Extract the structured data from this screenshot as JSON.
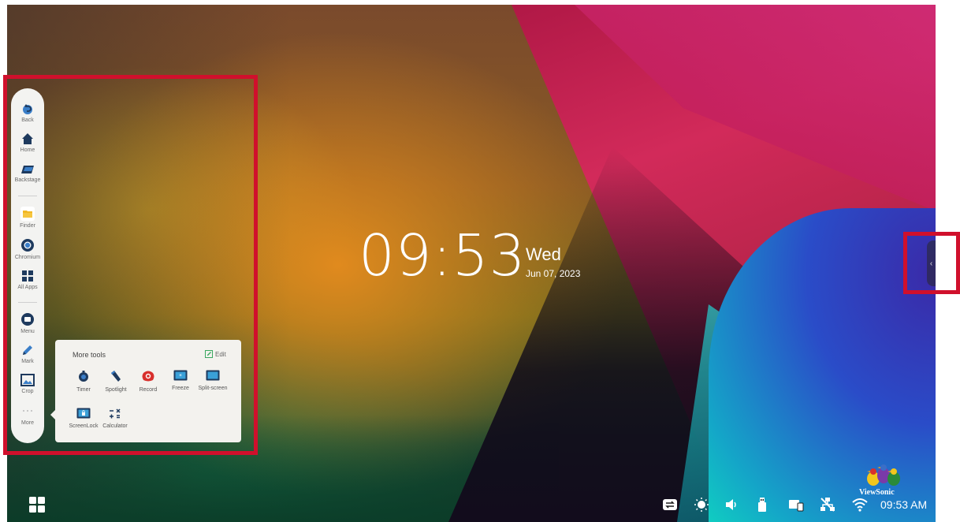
{
  "clock": {
    "time": "09:53",
    "day": "Wed",
    "date": "Jun 07, 2023"
  },
  "sidebar": {
    "items": [
      {
        "label": "Back",
        "icon": "back-icon"
      },
      {
        "label": "Home",
        "icon": "home-icon"
      },
      {
        "label": "Backstage",
        "icon": "backstage-icon"
      },
      {
        "label": "Finder",
        "icon": "folder-icon"
      },
      {
        "label": "Chromium",
        "icon": "chromium-icon"
      },
      {
        "label": "All Apps",
        "icon": "grid-icon"
      },
      {
        "label": "Menu",
        "icon": "menu-icon"
      },
      {
        "label": "Mark",
        "icon": "pen-icon"
      },
      {
        "label": "Crop",
        "icon": "crop-icon"
      },
      {
        "label": "More",
        "icon": "more-dots-icon"
      }
    ]
  },
  "tools_panel": {
    "title": "More tools",
    "edit_label": "Edit",
    "tools": [
      {
        "label": "Timer",
        "icon": "timer-icon"
      },
      {
        "label": "Spotlight",
        "icon": "spotlight-icon"
      },
      {
        "label": "Record",
        "icon": "record-icon"
      },
      {
        "label": "Freeze",
        "icon": "freeze-icon"
      },
      {
        "label": "Split-screen",
        "icon": "split-screen-icon"
      },
      {
        "label": "ScreenLock",
        "icon": "screenlock-icon"
      },
      {
        "label": "Calculator",
        "icon": "calculator-icon"
      }
    ]
  },
  "status_bar": {
    "time": "09:53 AM",
    "logo_text": "ViewSonic"
  },
  "colors": {
    "annotation": "#d0102c",
    "panel_bg": "#f3f2ee",
    "sidebar_bg": "#f3f3f1"
  }
}
